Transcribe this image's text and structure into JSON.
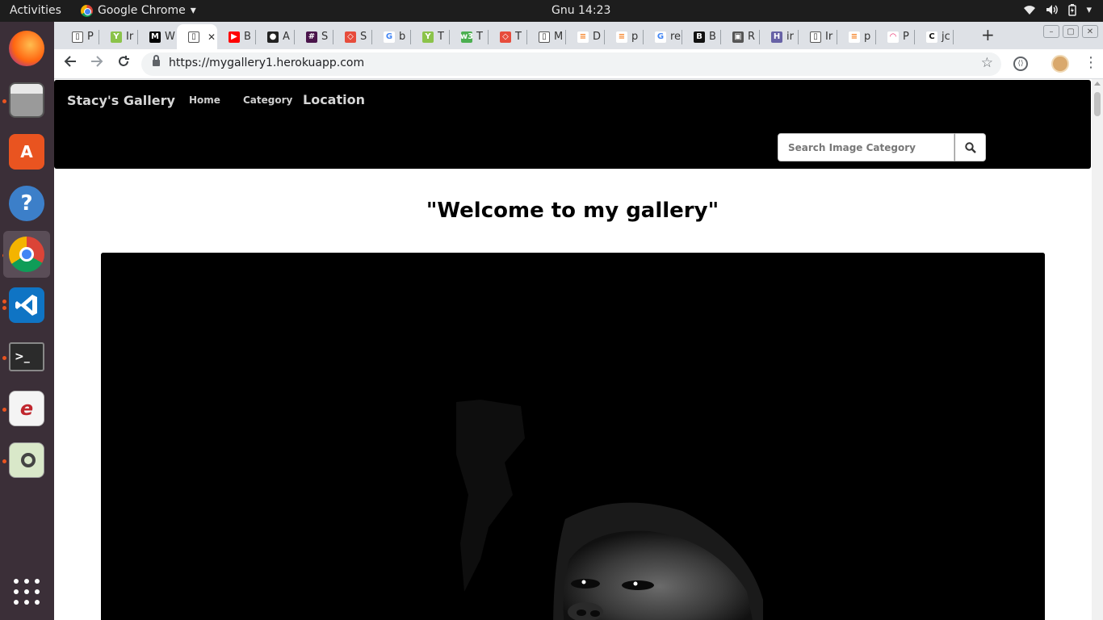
{
  "topbar": {
    "activities": "Activities",
    "app_name": "Google Chrome",
    "clock": "Gnu 14:23"
  },
  "dock": {
    "items": [
      "firefox-icon",
      "files-icon",
      "software-center-icon",
      "help-icon",
      "chrome-icon",
      "vscode-icon",
      "terminal-icon",
      "document-viewer-icon",
      "image-viewer-icon"
    ]
  },
  "tabs": [
    {
      "icon": "page-icon",
      "label": "P"
    },
    {
      "icon": "tree-icon",
      "label": "Ir"
    },
    {
      "icon": "medium-icon",
      "label": "W"
    },
    {
      "icon": "page-icon",
      "label": "",
      "active": true
    },
    {
      "icon": "youtube-icon",
      "label": "B"
    },
    {
      "icon": "github-icon",
      "label": "A"
    },
    {
      "icon": "slack-icon",
      "label": "S"
    },
    {
      "icon": "codepen-icon",
      "label": "S"
    },
    {
      "icon": "google-icon",
      "label": "b"
    },
    {
      "icon": "tree-icon",
      "label": "T"
    },
    {
      "icon": "w3-icon",
      "label": "T"
    },
    {
      "icon": "codepen-icon",
      "label": "T"
    },
    {
      "icon": "page-icon",
      "label": "M"
    },
    {
      "icon": "stackoverflow-icon",
      "label": "D"
    },
    {
      "icon": "stackoverflow-icon",
      "label": "p"
    },
    {
      "icon": "google-icon",
      "label": "re"
    },
    {
      "icon": "behance-icon",
      "label": "B"
    },
    {
      "icon": "folder-icon",
      "label": "R"
    },
    {
      "icon": "heroku-icon",
      "label": "ir"
    },
    {
      "icon": "page-icon",
      "label": "Ir"
    },
    {
      "icon": "stackoverflow-icon",
      "label": "p"
    },
    {
      "icon": "rainbow-icon",
      "label": "P"
    },
    {
      "icon": "c-icon",
      "label": "jc"
    }
  ],
  "toolbar": {
    "url": "https://mygallery1.herokuapp.com"
  },
  "site": {
    "brand": "Stacy's Gallery",
    "nav": {
      "home": "Home",
      "category": "Category",
      "location": "Location"
    },
    "search": {
      "placeholder": "Search Image Category"
    },
    "welcome": "\"Welcome to my gallery\""
  },
  "colors": {
    "navbar_bg": "#000000",
    "dock_bg": "#3b2f38",
    "topbar_bg": "#1d1d1d",
    "tabstrip_bg": "#dee1e6"
  }
}
